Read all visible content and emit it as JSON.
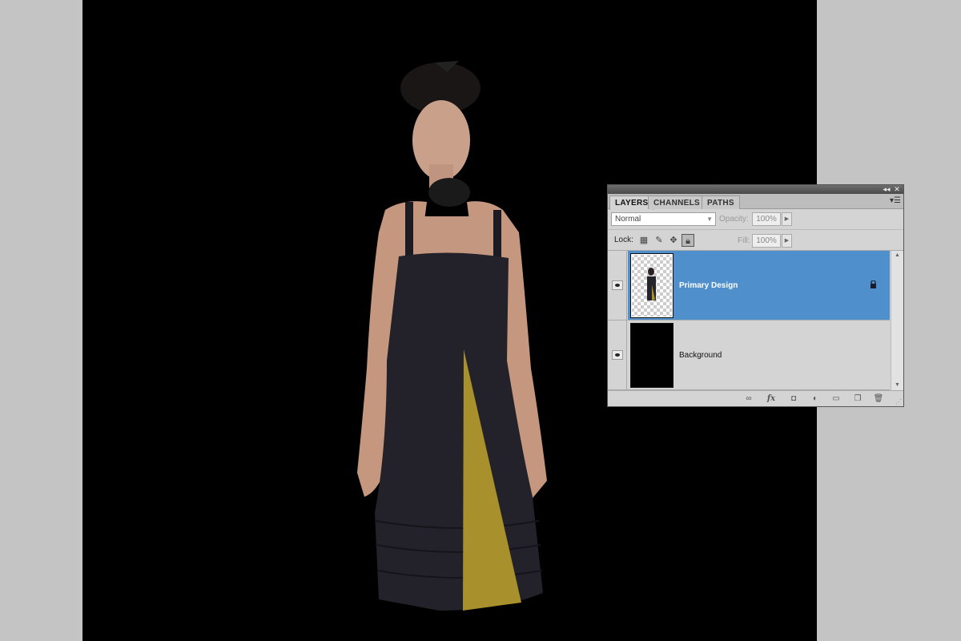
{
  "panel": {
    "tabs": [
      "LAYERS",
      "CHANNELS",
      "PATHS"
    ],
    "active_tab": "LAYERS",
    "menu_icon": "panel-menu-icon",
    "collapse_icon": "double-chevron-left-icon",
    "close_icon": "close-icon"
  },
  "blend": {
    "mode": "Normal",
    "opacity_label": "Opacity:",
    "opacity_value": "100%"
  },
  "lock": {
    "label": "Lock:",
    "fill_label": "Fill:",
    "fill_value": "100%"
  },
  "layers": [
    {
      "name": "Primary Design",
      "visible": true,
      "selected": true,
      "locked": true,
      "thumbnail": "transparent-with-figure"
    },
    {
      "name": "Background",
      "visible": true,
      "selected": false,
      "locked": false,
      "thumbnail": "black-fill"
    }
  ],
  "bottom_bar": {
    "icons": [
      "link-layers-icon",
      "fx-icon",
      "add-mask-icon",
      "adjustment-layer-icon",
      "new-group-icon",
      "new-layer-icon",
      "trash-icon"
    ],
    "fx_text": "fx"
  },
  "colors": {
    "selection": "#4f8fcc",
    "canvas": "#000000",
    "workspace": "#c4c4c4",
    "dress": "#23222a",
    "dress_panel": "#a8902c"
  }
}
